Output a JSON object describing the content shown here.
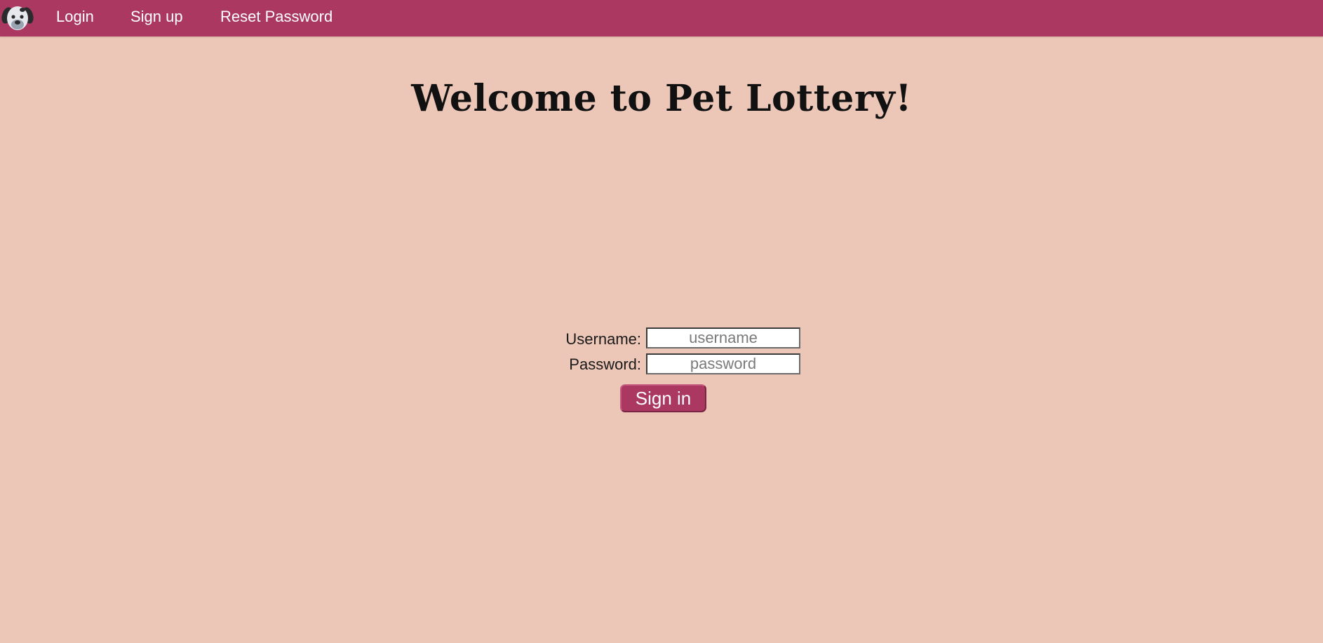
{
  "nav": {
    "logo_icon": "dog-face-icon",
    "links": [
      {
        "label": "Login"
      },
      {
        "label": "Sign up"
      },
      {
        "label": "Reset Password"
      }
    ]
  },
  "main": {
    "title": "Welcome to Pet Lottery!"
  },
  "form": {
    "username_label": "Username:",
    "username_placeholder": "username",
    "username_value": "",
    "password_label": "Password:",
    "password_placeholder": "password",
    "password_value": "",
    "submit_label": "Sign in"
  },
  "colors": {
    "background": "#ecc6b7",
    "accent": "#aa3860"
  }
}
